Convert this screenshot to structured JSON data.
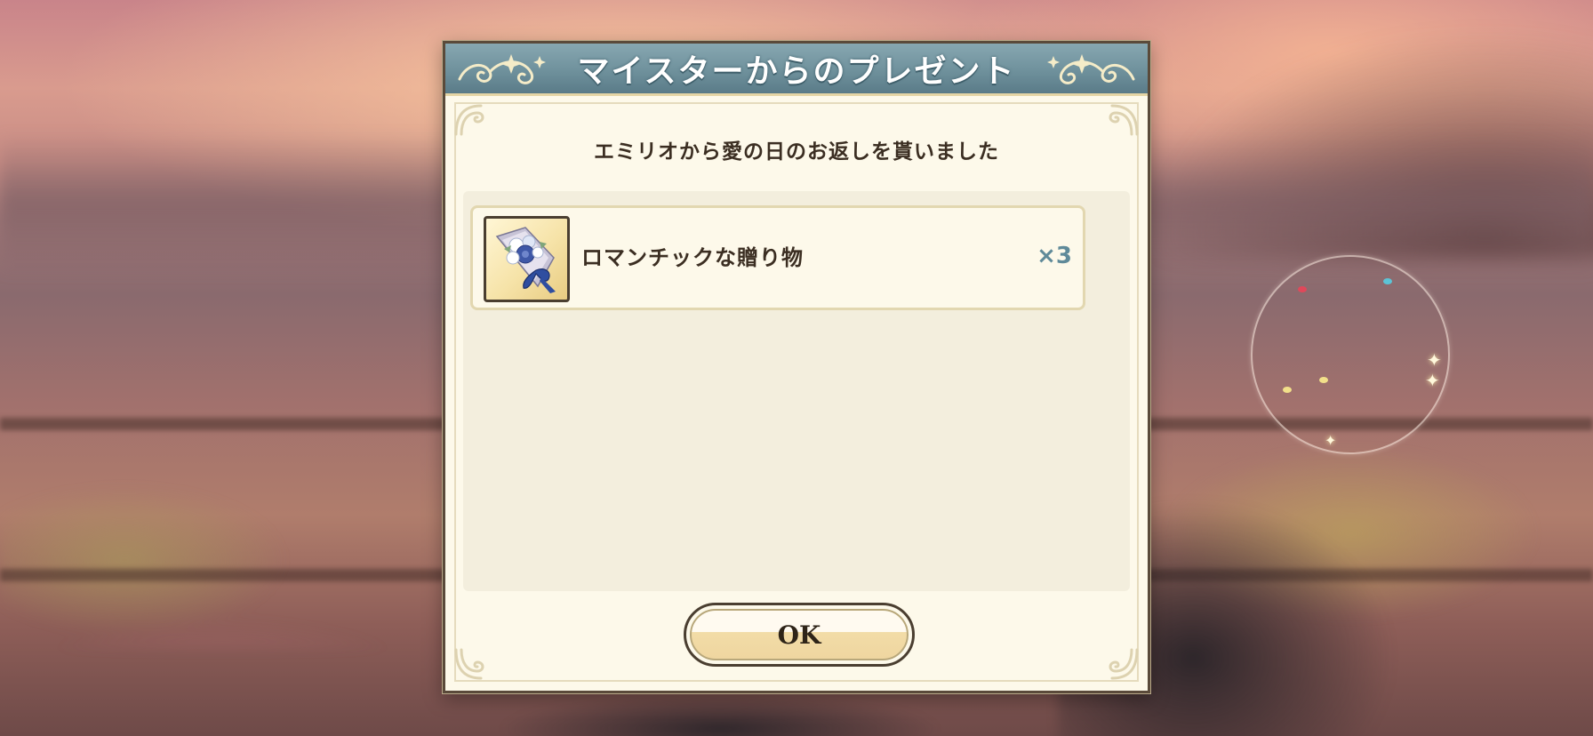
{
  "dialog": {
    "title": "マイスターからのプレゼント",
    "message": "エミリオから愛の日のお返しを貰いました",
    "ok_label": "OK"
  },
  "rewards": [
    {
      "name": "ロマンチックな贈り物",
      "quantity": "×3",
      "icon": "bouquet-icon"
    }
  ],
  "colors": {
    "header": "#6f919c",
    "panel": "#fdf9ea",
    "quantity_text": "#5f8a99",
    "text": "#3b2e22"
  }
}
